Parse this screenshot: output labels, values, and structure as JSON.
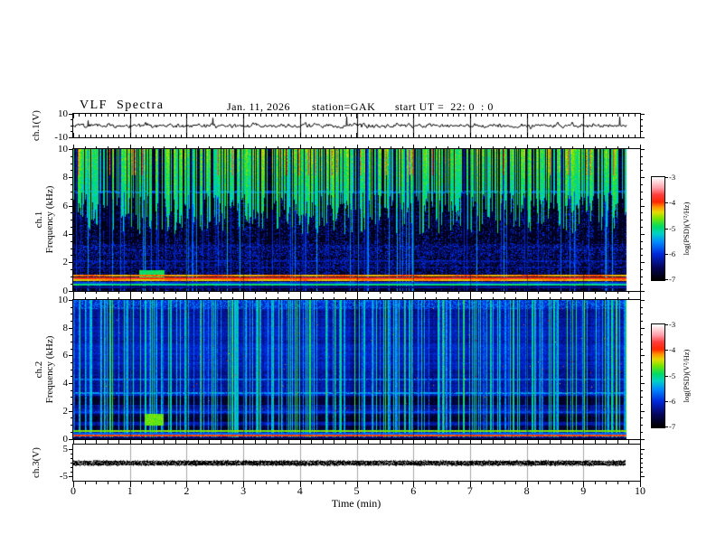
{
  "header": {
    "title": "VLF  Spectra",
    "date": "Jan. 11, 2026",
    "station": "station=GAK",
    "start_ut": "start UT =  22: 0  : 0"
  },
  "axes": {
    "x_label": "Time  (min)",
    "x_ticks": [
      "0",
      "1",
      "2",
      "3",
      "4",
      "5",
      "6",
      "7",
      "8",
      "9",
      "10"
    ],
    "x_minutes": [
      0,
      1,
      2,
      3,
      4,
      5,
      6,
      7,
      8,
      9,
      10
    ],
    "wf_ylabel": "ch.1(V)",
    "wf_yticks": [
      "10",
      "-10"
    ],
    "sp1_ylabel_line1": "ch.1",
    "sp1_ylabel_line2": "Frequency  (kHz)",
    "sp2_ylabel_line1": "ch.2",
    "sp2_ylabel_line2": "Frequency  (kHz)",
    "freq_yticks": [
      "10",
      "8",
      "6",
      "4",
      "2",
      "0"
    ],
    "ch3_ylabel": "ch.3(V)",
    "ch3_yticks": [
      "5",
      "-5"
    ]
  },
  "colorbar": {
    "label": "log(PSD)(V²/Hz)",
    "ticks": [
      "-3",
      "-4",
      "-5",
      "-6",
      "-7"
    ],
    "values": [
      -3,
      -4,
      -5,
      -6,
      -7
    ]
  },
  "colormap": {
    "stops": [
      [
        0,
        "#000000"
      ],
      [
        0.12,
        "#05055a"
      ],
      [
        0.25,
        "#0028dc"
      ],
      [
        0.37,
        "#008cff"
      ],
      [
        0.45,
        "#00d2c8"
      ],
      [
        0.52,
        "#00dc64"
      ],
      [
        0.6,
        "#78e600"
      ],
      [
        0.66,
        "#e6dc00"
      ],
      [
        0.71,
        "#ff9600"
      ],
      [
        0.76,
        "#ff2800"
      ],
      [
        0.83,
        "#ff3c3c"
      ],
      [
        0.9,
        "#ffa0aa"
      ],
      [
        1,
        "#ffffff"
      ]
    ]
  },
  "chart_data": [
    {
      "type": "line",
      "name": "ch1_waveform",
      "ylabel": "ch.1(V)",
      "ylim": [
        -10,
        10
      ],
      "yticks": [
        10,
        -10
      ],
      "xlim_min": [
        0,
        10
      ],
      "x_end_min": 9.75,
      "summary": "broadband noise trace oscillating about 0 V (~±2 V) with sporadic impulsive spikes reaching ~±7 V"
    },
    {
      "type": "heatmap",
      "name": "ch1_spectrogram",
      "ylabel": "ch.1 Frequency (kHz)",
      "ylim": [
        0,
        10
      ],
      "yticks": [
        0,
        2,
        4,
        6,
        8,
        10
      ],
      "zlabel": "log(PSD)(V²/Hz)",
      "zlim": [
        -7,
        -3
      ],
      "x_end_min": 9.75,
      "features": {
        "sferic_streaks": {
          "density": 0.62,
          "penetration_khz": [
            3,
            6
          ],
          "psd": [
            -5.4,
            -4.4
          ]
        },
        "quiet_band_khz": [
          3.3,
          7.2
        ],
        "hum_bands": [
          {
            "f": [
              1.0,
              1.13
            ],
            "psd": -4.15
          },
          {
            "f": [
              0.84,
              0.97
            ],
            "psd": -3.85
          },
          {
            "f": [
              0.68,
              0.8
            ],
            "psd": -4.25
          },
          {
            "f": [
              0.52,
              0.64
            ],
            "psd": -5.9
          },
          {
            "f": [
              0.38,
              0.5
            ],
            "psd": -5.0
          },
          {
            "f": [
              0.2,
              0.34
            ],
            "psd": -6.3
          }
        ],
        "tonal_lines": [
          {
            "f": 7.0,
            "psd": -5.8
          },
          {
            "f": 2.1,
            "psd": -6.2
          },
          {
            "f": 1.65,
            "psd": -6.35
          }
        ],
        "blob": {
          "t_min": [
            1.15,
            1.6
          ],
          "f_khz": [
            0.95,
            1.5
          ],
          "psd": -4.9
        }
      }
    },
    {
      "type": "heatmap",
      "name": "ch2_spectrogram",
      "ylabel": "ch.2 Frequency (kHz)",
      "ylim": [
        0,
        10
      ],
      "yticks": [
        0,
        2,
        4,
        6,
        8,
        10
      ],
      "zlabel": "log(PSD)(V²/Hz)",
      "zlim": [
        -7,
        -3
      ],
      "x_end_min": 9.75,
      "features": {
        "base_psd": [
          -6.6,
          -5.7
        ],
        "streaks": {
          "density": 0.28,
          "psd": [
            -5.8,
            -5.0
          ]
        },
        "dark_bands_khz": [
          [
            2.5,
            3.1
          ],
          [
            1.25,
            1.8
          ],
          [
            0.66,
            0.95
          ]
        ],
        "tonal_lines": [
          {
            "f": 6.1,
            "psd": -6.1
          },
          {
            "f": 4.3,
            "psd": -5.7
          },
          {
            "f": 3.3,
            "psd": -5.5
          },
          {
            "f": 1.95,
            "psd": -5.9
          }
        ],
        "bottom_bands": [
          {
            "f": [
              0.5,
              0.64
            ],
            "psd": -4.6
          },
          {
            "f": [
              0.34,
              0.46
            ],
            "psd": -5.7
          },
          {
            "f": [
              0.18,
              0.3
            ],
            "psd": -4.0
          },
          {
            "f": [
              0.0,
              0.15
            ],
            "psd": -6.6
          }
        ],
        "blob": {
          "t_min": [
            1.25,
            1.58
          ],
          "f_khz": [
            1.0,
            1.8
          ],
          "psd": -4.65
        }
      }
    },
    {
      "type": "line",
      "name": "ch3_waveform",
      "ylabel": "ch.3(V)",
      "ylim": [
        -5,
        5
      ],
      "yticks": [
        5,
        -5
      ],
      "x_end_min": 9.75,
      "summary": "flat dense trace pinned at 0 V for the entire record"
    }
  ]
}
